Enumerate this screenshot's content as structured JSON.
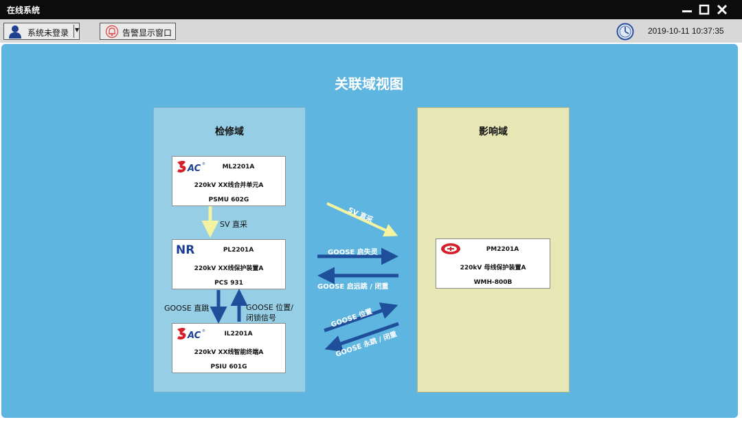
{
  "window": {
    "title": "在线系统"
  },
  "toolbar": {
    "login_label": "系统未登录",
    "alarm_label": "告警显示窗口",
    "datetime": "2019-10-11 10:37:35"
  },
  "view": {
    "title": "关联域视图",
    "maintenance_domain": {
      "title": "检修域",
      "devices": [
        {
          "logo": "SAC",
          "name": "ML2201A",
          "desc": "220kV XX线合并单元A",
          "model": "PSMU 602G"
        },
        {
          "logo": "NR",
          "name": "PL2201A",
          "desc": "220kV XX线保护装置A",
          "model": "PCS 931"
        },
        {
          "logo": "SAC",
          "name": "IL2201A",
          "desc": "220kV XX线智能终端A",
          "model": "PSIU 601G"
        }
      ],
      "links": {
        "sv_direct": "SV 直采",
        "goose_trip": "GOOSE 直跳",
        "goose_position_1": "GOOSE 位置/",
        "goose_position_2": "闭锁信号"
      }
    },
    "influence_domain": {
      "title": "影响域",
      "devices": [
        {
          "logo": "XJ",
          "name": "PM2201A",
          "desc": "220kV 母线保护装置A",
          "model": "WMH-800B"
        }
      ]
    },
    "cross_links": {
      "sv_direct": "SV 直采",
      "goose_start_failure": "GOOSE 启失灵",
      "goose_remote_trip": "GOOSE 启远跳 / 闭重",
      "goose_position": "GOOSE 位置",
      "goose_permanent_trip": "GOOSE 永跳 / 闭重"
    }
  },
  "colors": {
    "background": "#5eb5e0",
    "maintenance_panel": "#96cee6",
    "influence_panel": "#e7e7b5",
    "arrow_blue": "#1f4e9a",
    "arrow_yellow": "#f3f3a0"
  }
}
